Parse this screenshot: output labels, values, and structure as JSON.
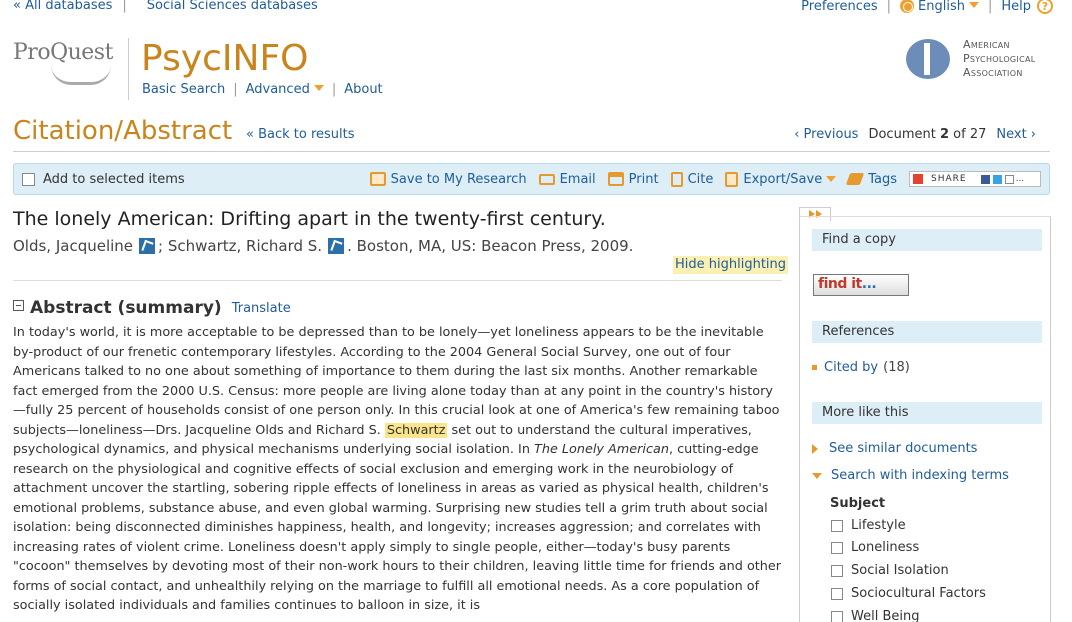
{
  "topbar": {
    "all_databases": "« All databases",
    "social_sciences": "Social Sciences databases",
    "preferences": "Preferences",
    "language": "English",
    "help": "Help",
    "help_glyph": "?"
  },
  "header": {
    "logo_text": "ProQuest",
    "product": "PsycINFO",
    "nav": [
      "Basic Search",
      "Advanced",
      "About"
    ],
    "apa_lines": [
      "American",
      "Psychological",
      "Association"
    ]
  },
  "page": {
    "title": "Citation/Abstract",
    "back": "« Back to results",
    "previous": "‹ Previous",
    "doc_prefix": "Document",
    "doc_current": "2",
    "doc_of": "of 27",
    "next": "Next ›"
  },
  "toolbar": {
    "add_selected": "Add to selected items",
    "save": "Save to My Research",
    "email": "Email",
    "print": "Print",
    "cite": "Cite",
    "export": "Export/Save",
    "tags": "Tags",
    "share": "SHARE",
    "more": "..."
  },
  "record": {
    "title": "The lonely American: Drifting apart in the twenty-first century.",
    "author1": "Olds, Jacqueline",
    "author2": "; Schwartz, Richard S.",
    "publisher": ". Boston, MA, US: Beacon Press, 2009.",
    "hide_highlighting": "Hide highlighting",
    "abstract_title": "Abstract (summary)",
    "translate": "Translate",
    "abstract_part1": "In today's world, it is more acceptable to be depressed than to be lonely—yet loneliness appears to be the inevitable by-product of our frenetic contemporary lifestyles. According to the 2004 General Social Survey, one out of four Americans talked to no one about something of importance to them during the last six months. Another remarkable fact emerged from the 2000 U.S. Census: more people are living alone today than at any point in the country's history—fully 25 percent of households consist of one person only. In this crucial look at one of America's few remaining taboo subjects—loneliness—Drs. Jacqueline Olds and Richard S.",
    "abstract_highlight": "Schwartz",
    "abstract_part2": "set out to understand the cultural imperatives, psychological dynamics, and physical mechanisms underlying social isolation. In",
    "abstract_italic": "The Lonely American",
    "abstract_part3": ", cutting-edge research on the physiological and cognitive effects of social exclusion and emerging work in the neurobiology of attachment uncover the startling, sobering ripple effects of loneliness in areas as varied as physical health, children's emotional problems, substance abuse, and even global warming. Surprising new studies tell a grim truth about social isolation: being disconnected diminishes happiness, health, and longevity; increases aggression; and correlates with increasing rates of violent crime. Loneliness doesn't apply simply to single people, either—today's busy parents \"cocoon\" themselves by devoting most of their non-work hours to their children, leaving little time for friends and other forms of social contact, and unhealthily relying on the marriage to fulfill all emotional needs. As a core population of socially isolated individuals and families continues to balloon in size, it is"
  },
  "sidebar": {
    "find_copy": "Find a copy",
    "findit": "find it",
    "findit_dots": "...",
    "references": "References",
    "cited_by": "Cited by",
    "cited_count": "(18)",
    "more_like_this": "More like this",
    "see_similar": "See similar documents",
    "search_indexing": "Search with indexing terms",
    "subject_label": "Subject",
    "subjects": [
      "Lifestyle",
      "Loneliness",
      "Social Isolation",
      "Sociocultural Factors",
      "Well Being"
    ]
  },
  "colors": {
    "accent_orange": "#c9841c",
    "link_blue": "#1f5c99",
    "toolbar_bg": "#ddeef7",
    "highlight": "#fbe58a"
  }
}
